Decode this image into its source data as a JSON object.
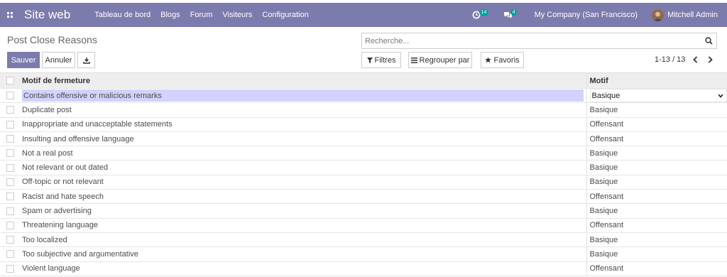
{
  "navbar": {
    "app_name": "Site web",
    "menu": [
      "Tableau de bord",
      "Blogs",
      "Forum",
      "Visiteurs",
      "Configuration"
    ],
    "activity_badge": "14",
    "message_badge": "4",
    "company": "My Company (San Francisco)",
    "user": "Mitchell Admin"
  },
  "page": {
    "title": "Post Close Reasons",
    "search_placeholder": "Recherche...",
    "save_label": "Sauver",
    "discard_label": "Annuler",
    "filters_label": "Filtres",
    "groupby_label": "Regrouper par",
    "favorites_label": "Favoris",
    "pager": "1-13 / 13"
  },
  "table": {
    "columns": [
      "Motif de fermeture",
      "Motif"
    ],
    "rows": [
      {
        "name": "Contains offensive or malicious remarks",
        "motif": "Basique"
      },
      {
        "name": "Duplicate post",
        "motif": "Basique"
      },
      {
        "name": "Inappropriate and unacceptable statements",
        "motif": "Offensant"
      },
      {
        "name": "Insulting and offensive language",
        "motif": "Offensant"
      },
      {
        "name": "Not a real post",
        "motif": "Basique"
      },
      {
        "name": "Not relevant or out dated",
        "motif": "Basique"
      },
      {
        "name": "Off-topic or not relevant",
        "motif": "Basique"
      },
      {
        "name": "Racist and hate speech",
        "motif": "Offensant"
      },
      {
        "name": "Spam or advertising",
        "motif": "Basique"
      },
      {
        "name": "Threatening language",
        "motif": "Offensant"
      },
      {
        "name": "Too localized",
        "motif": "Basique"
      },
      {
        "name": "Too subjective and argumentative",
        "motif": "Basique"
      },
      {
        "name": "Violent language",
        "motif": "Offensant"
      }
    ]
  },
  "colors": {
    "brand": "#7c7bad",
    "badge": "#00a09d",
    "editing_row": "#d2d2ff"
  }
}
